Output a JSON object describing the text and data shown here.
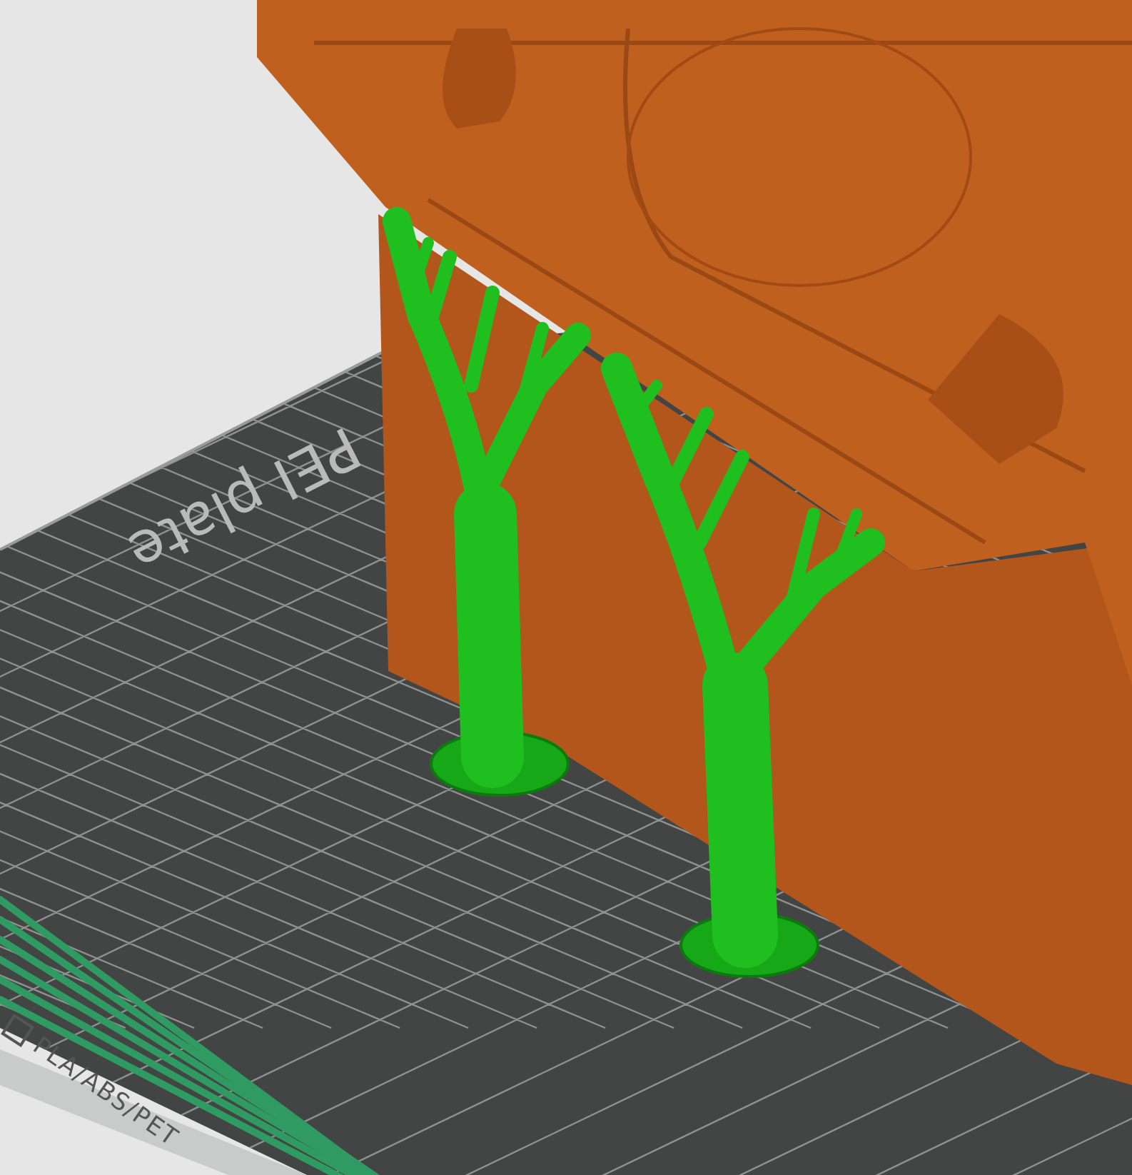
{
  "viewport": {
    "bed_labels": [
      {
        "kind": "plate",
        "text": "PEI plate"
      },
      {
        "kind": "filament",
        "text": "PLA/ABS/PET"
      }
    ]
  }
}
